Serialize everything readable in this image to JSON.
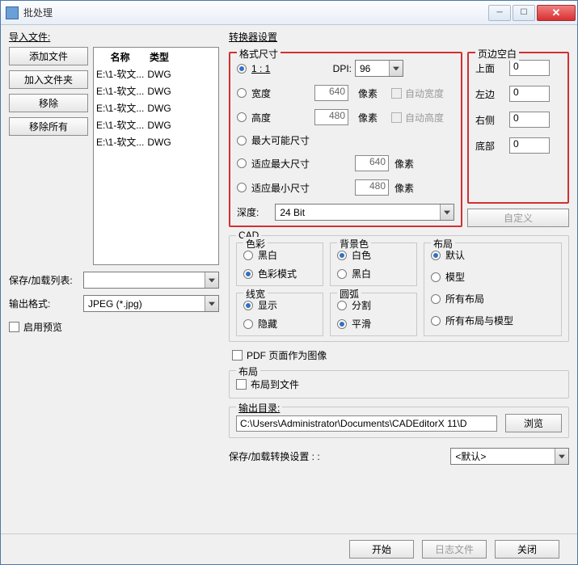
{
  "title": "批处理",
  "left": {
    "import_label": "导入文件:",
    "btn_add_file": "添加文件",
    "btn_add_folder": "加入文件夹",
    "btn_remove": "移除",
    "btn_remove_all": "移除所有",
    "col_name": "名称",
    "col_type": "类型",
    "files": [
      {
        "name": "E:\\1-软文...",
        "type": "DWG"
      },
      {
        "name": "E:\\1-软文...",
        "type": "DWG"
      },
      {
        "name": "E:\\1-软文...",
        "type": "DWG"
      },
      {
        "name": "E:\\1-软文...",
        "type": "DWG"
      },
      {
        "name": "E:\\1-软文...",
        "type": "DWG"
      }
    ],
    "save_load_list": "保存/加载列表:",
    "output_format_label": "输出格式:",
    "output_format_value": "JPEG (*.jpg)",
    "enable_preview": "启用预览"
  },
  "converter_label": "转换器设置",
  "format_size": {
    "title": "格式尺寸",
    "ratio": "1 : 1",
    "dpi_label": "DPI:",
    "dpi_value": "96",
    "width_label": "宽度",
    "width_value": "640",
    "height_label": "高度",
    "height_value": "480",
    "px": "像素",
    "auto_width": "自动宽度",
    "auto_height": "自动高度",
    "max_possible": "最大可能尺寸",
    "fit_max": "适应最大尺寸",
    "fit_max_val": "640",
    "fit_min": "适应最小尺寸",
    "fit_min_val": "480",
    "depth_label": "深度:",
    "depth_value": "24 Bit"
  },
  "margins": {
    "title": "页边空白",
    "top": "上面",
    "top_v": "0",
    "left": "左边",
    "left_v": "0",
    "right": "右侧",
    "right_v": "0",
    "bottom": "底部",
    "bottom_v": "0",
    "custom": "自定义"
  },
  "cad": {
    "title": "CAD",
    "color_title": "色彩",
    "color_bw": "黑白",
    "color_mode": "色彩模式",
    "bg_title": "背景色",
    "bg_white": "白色",
    "bg_black": "黑白",
    "layout_title": "布局",
    "layout_default": "默认",
    "layout_model": "模型",
    "layout_all": "所有布局",
    "layout_all_model": "所有布局与模型",
    "lw_title": "线宽",
    "lw_show": "显示",
    "lw_hide": "隐藏",
    "arc_title": "圆弧",
    "arc_split": "分割",
    "arc_smooth": "平滑"
  },
  "pdf_as_image": "PDF 页面作为图像",
  "layout2": {
    "title": "布局",
    "to_file": "布局到文件"
  },
  "outdir_label": "输出目录:",
  "outdir_value": "C:\\Users\\Administrator\\Documents\\CADEditorX 11\\D",
  "browse": "浏览",
  "save_load_conv": "保存/加载转换设置 : :",
  "save_load_conv_value": "<默认>",
  "footer": {
    "start": "开始",
    "log": "日志文件",
    "close": "关闭"
  }
}
